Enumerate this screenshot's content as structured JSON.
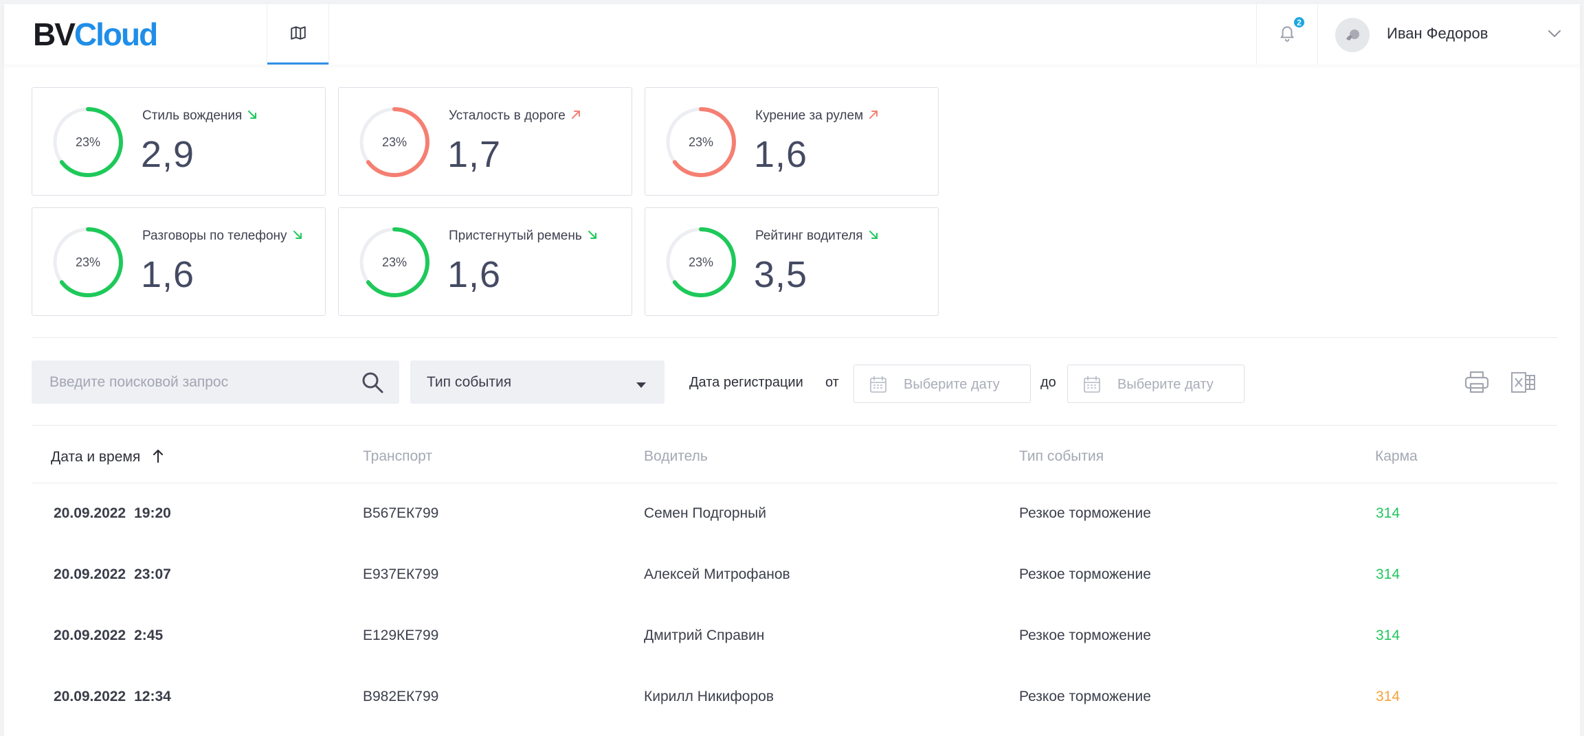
{
  "app": {
    "logo_bv": "BV",
    "logo_cloud": "Cloud"
  },
  "header": {
    "notifications_count": "2",
    "user_name": "Иван Федоров"
  },
  "colors": {
    "accent": "#2f8fe8",
    "gauge_green": "#1ec95a",
    "gauge_red": "#f57f72",
    "karma_green": "#22c55e",
    "karma_orange": "#f6a23c"
  },
  "cards": [
    {
      "label": "Стиль вождения",
      "percent": "23%",
      "value": "2,9",
      "trend": "down",
      "color": "green"
    },
    {
      "label": "Усталость в дороге",
      "percent": "23%",
      "value": "1,7",
      "trend": "up",
      "color": "red"
    },
    {
      "label": "Курение за рулем",
      "percent": "23%",
      "value": "1,6",
      "trend": "up",
      "color": "red"
    },
    {
      "label": "Разговоры по телефону",
      "percent": "23%",
      "value": "1,6",
      "trend": "down",
      "color": "green"
    },
    {
      "label": "Пристегнутый ремень",
      "percent": "23%",
      "value": "1,6",
      "trend": "down",
      "color": "green"
    },
    {
      "label": "Рейтинг водителя",
      "percent": "23%",
      "value": "3,5",
      "trend": "down",
      "color": "green"
    }
  ],
  "filters": {
    "search_placeholder": "Введите поисковой запрос",
    "event_type": "Тип события",
    "reg_date_label": "Дата регистрации",
    "from_label": "от",
    "to_label": "до",
    "date_placeholder": "Выберите дату"
  },
  "table": {
    "columns": [
      "Дата и время",
      "Транспорт",
      "Водитель",
      "Тип события",
      "Карма"
    ],
    "rows": [
      {
        "date": "20.09.2022",
        "time": "19:20",
        "vehicle": "В567ЕК799",
        "driver": "Семен Подгорный",
        "event": "Резкое торможение",
        "karma": "314",
        "karma_color": "green"
      },
      {
        "date": "20.09.2022",
        "time": "23:07",
        "vehicle": "Е937ЕК799",
        "driver": "Алексей Митрофанов",
        "event": "Резкое торможение",
        "karma": "314",
        "karma_color": "green"
      },
      {
        "date": "20.09.2022",
        "time": "2:45",
        "vehicle": "Е129КЕ799",
        "driver": "Дмитрий Справин",
        "event": "Резкое торможение",
        "karma": "314",
        "karma_color": "green"
      },
      {
        "date": "20.09.2022",
        "time": "12:34",
        "vehicle": "В982ЕК799",
        "driver": "Кирилл Никифоров",
        "event": "Резкое торможение",
        "karma": "314",
        "karma_color": "orange"
      }
    ]
  }
}
